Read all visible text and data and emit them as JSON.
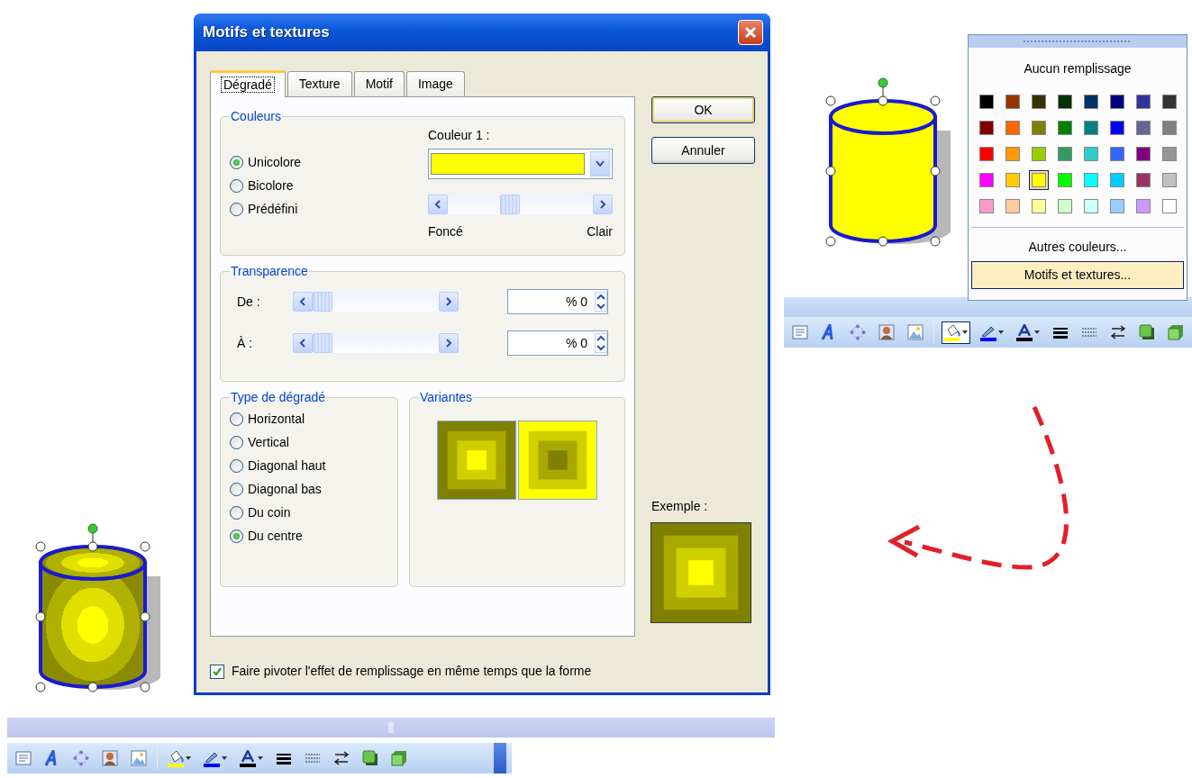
{
  "dialog": {
    "title": "Motifs et textures",
    "tabs": [
      {
        "label": "Dégradé",
        "selected": true
      },
      {
        "label": "Texture",
        "selected": false
      },
      {
        "label": "Motif",
        "selected": false
      },
      {
        "label": "Image",
        "selected": false
      }
    ],
    "colors_group": {
      "title": "Couleurs",
      "options": [
        {
          "label": "Unicolore",
          "selected": true
        },
        {
          "label": "Bicolore",
          "selected": false
        },
        {
          "label": "Prédéfini",
          "selected": false
        }
      ],
      "color_label": "Couleur 1 :",
      "color": "#ffff00",
      "shade": {
        "level": 0.42
      },
      "dark_label": "Foncé",
      "light_label": "Clair"
    },
    "transparency_group": {
      "title": "Transparence",
      "rows": [
        {
          "label": "De :",
          "level": 0,
          "value": "% 0"
        },
        {
          "label": "À :",
          "level": 0,
          "value": "% 0"
        }
      ]
    },
    "gradient_type_group": {
      "title": "Type de dégradé",
      "options": [
        {
          "label": "Horizontal",
          "selected": false
        },
        {
          "label": "Vertical",
          "selected": false
        },
        {
          "label": "Diagonal haut",
          "selected": false
        },
        {
          "label": "Diagonal bas",
          "selected": false
        },
        {
          "label": "Du coin",
          "selected": false
        },
        {
          "label": "Du centre",
          "selected": true
        }
      ]
    },
    "variants_group": {
      "title": "Variantes"
    },
    "preview_label": "Exemple :",
    "rotate_checkbox": {
      "label": "Faire pivoter l'effet de remplissage en même temps que la forme",
      "checked": true
    },
    "buttons": [
      "OK",
      "Annuler"
    ]
  },
  "color_menu": {
    "no_fill": "Aucun remplissage",
    "swatches": [
      {
        "color": "#000000",
        "selected": false
      },
      {
        "color": "#993300",
        "selected": false
      },
      {
        "color": "#333300",
        "selected": false
      },
      {
        "color": "#003300",
        "selected": false
      },
      {
        "color": "#003366",
        "selected": false
      },
      {
        "color": "#000080",
        "selected": false
      },
      {
        "color": "#333399",
        "selected": false
      },
      {
        "color": "#333333",
        "selected": false
      },
      {
        "color": "#800000",
        "selected": false
      },
      {
        "color": "#ff6600",
        "selected": false
      },
      {
        "color": "#808000",
        "selected": false
      },
      {
        "color": "#008000",
        "selected": false
      },
      {
        "color": "#008080",
        "selected": false
      },
      {
        "color": "#0000ff",
        "selected": false
      },
      {
        "color": "#666699",
        "selected": false
      },
      {
        "color": "#808080",
        "selected": false
      },
      {
        "color": "#ff0000",
        "selected": false
      },
      {
        "color": "#ff9900",
        "selected": false
      },
      {
        "color": "#99cc00",
        "selected": false
      },
      {
        "color": "#339966",
        "selected": false
      },
      {
        "color": "#33cccc",
        "selected": false
      },
      {
        "color": "#3366ff",
        "selected": false
      },
      {
        "color": "#800080",
        "selected": false
      },
      {
        "color": "#969696",
        "selected": false
      },
      {
        "color": "#ff00ff",
        "selected": false
      },
      {
        "color": "#ffcc00",
        "selected": false
      },
      {
        "color": "#ffff00",
        "selected": true
      },
      {
        "color": "#00ff00",
        "selected": false
      },
      {
        "color": "#00ffff",
        "selected": false
      },
      {
        "color": "#00ccff",
        "selected": false
      },
      {
        "color": "#993366",
        "selected": false
      },
      {
        "color": "#c0c0c0",
        "selected": false
      },
      {
        "color": "#ff99cc",
        "selected": false
      },
      {
        "color": "#ffcc99",
        "selected": false
      },
      {
        "color": "#ffff99",
        "selected": false
      },
      {
        "color": "#ccffcc",
        "selected": false
      },
      {
        "color": "#ccffff",
        "selected": false
      },
      {
        "color": "#99ccff",
        "selected": false
      },
      {
        "color": "#cc99ff",
        "selected": false
      },
      {
        "color": "#ffffff",
        "selected": false
      }
    ],
    "more_colors": "Autres couleurs...",
    "fill_effects": {
      "label": "Motifs et textures...",
      "highlighted": true
    }
  }
}
